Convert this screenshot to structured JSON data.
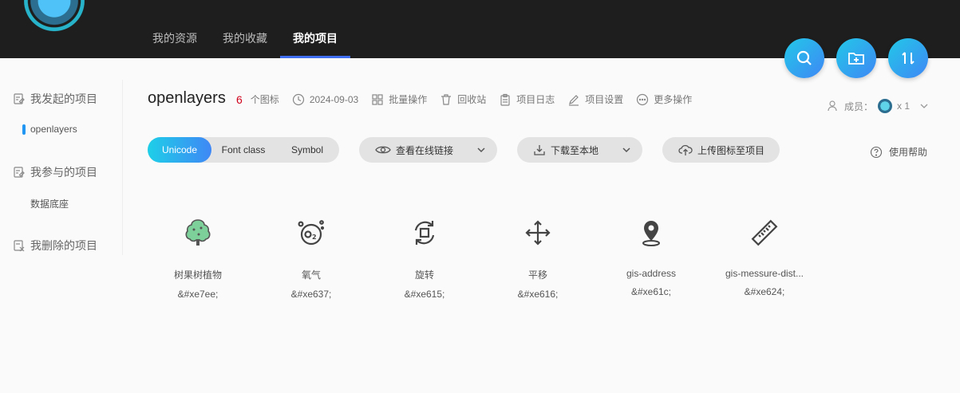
{
  "nav": {
    "items": [
      {
        "label": "我的资源"
      },
      {
        "label": "我的收藏"
      },
      {
        "label": "我的项目"
      }
    ]
  },
  "fabs": {
    "search": "search-icon",
    "new_folder": "folder-plus-icon",
    "sort": "sort-icon"
  },
  "sidebar": {
    "groups": [
      {
        "label": "我发起的项目",
        "icon": "edit-doc-icon"
      },
      {
        "label": "我参与的项目",
        "icon": "edit-doc-icon"
      },
      {
        "label": "我删除的项目",
        "icon": "delete-doc-icon"
      }
    ],
    "subs": [
      {
        "label": "openlayers"
      },
      {
        "label": "数据底座"
      }
    ]
  },
  "project": {
    "title": "openlayers",
    "count": "6",
    "count_label": "个图标",
    "date": "2024-09-03",
    "actions": [
      "批量操作",
      "回收站",
      "项目日志",
      "项目设置",
      "更多操作"
    ],
    "members_label": "成员：",
    "members_count": "x 1"
  },
  "toolbar": {
    "formats": [
      "Unicode",
      "Font class",
      "Symbol"
    ],
    "view_link": "查看在线链接",
    "download": "下载至本地",
    "upload": "上传图标至项目",
    "help": "使用帮助"
  },
  "icons": [
    {
      "name": "树果树植物",
      "code": "&#xe7ee;"
    },
    {
      "name": "氧气",
      "code": "&#xe637;"
    },
    {
      "name": "旋转",
      "code": "&#xe615;"
    },
    {
      "name": "平移",
      "code": "&#xe616;"
    },
    {
      "name": "gis-address",
      "code": "&#xe61c;"
    },
    {
      "name": "gis-messure-dist...",
      "code": "&#xe624;"
    }
  ],
  "colors": {
    "header_bg": "#1e1e1e",
    "accent": "#3f87f5",
    "accent2": "#1ecfe8",
    "count": "#d0021b"
  }
}
